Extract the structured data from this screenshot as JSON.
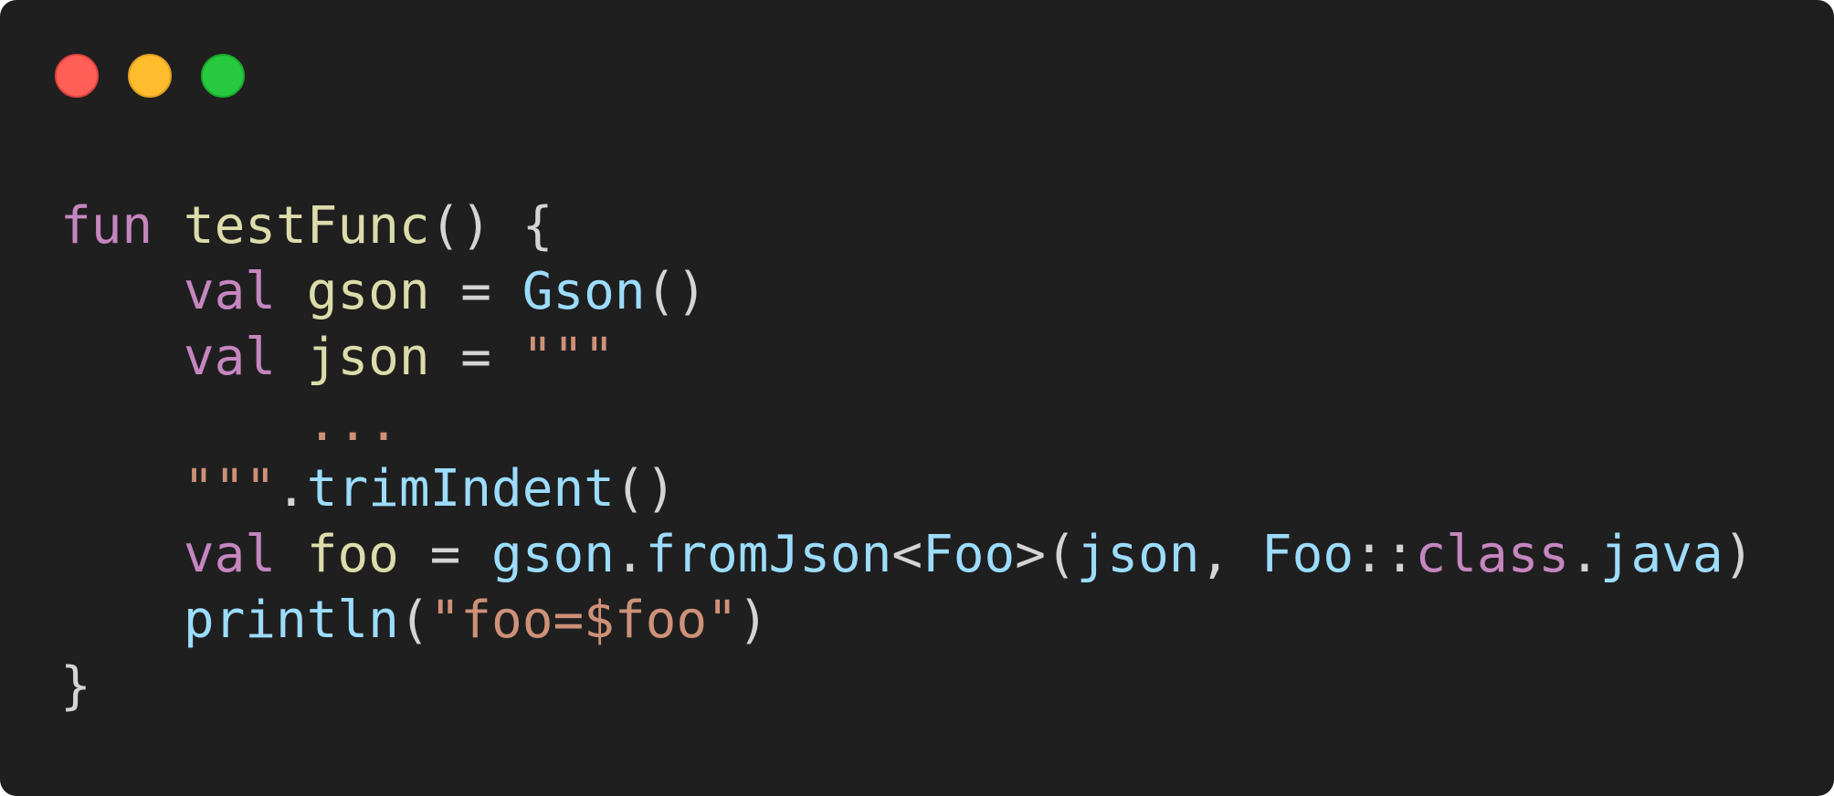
{
  "window": {
    "background": "#1f1f1f",
    "controls": [
      {
        "name": "close-button",
        "color": "#ff5f56",
        "border": "#e0443e"
      },
      {
        "name": "minimize-button",
        "color": "#ffbd2e",
        "border": "#dea123"
      },
      {
        "name": "zoom-button",
        "color": "#27c93f",
        "border": "#1aab29"
      }
    ]
  },
  "theme": {
    "keyword": "#c586c0",
    "variable": "#dcdcaa",
    "call": "#9cdcfe",
    "string": "#ce9178",
    "punctuation": "#d4d4d4"
  },
  "code": {
    "lines": [
      [
        {
          "text": "fun",
          "kind": "keyword"
        },
        {
          "text": " ",
          "kind": "punctuation"
        },
        {
          "text": "testFunc",
          "kind": "variable"
        },
        {
          "text": "() {",
          "kind": "punctuation"
        }
      ],
      [
        {
          "text": "    ",
          "kind": "punctuation"
        },
        {
          "text": "val",
          "kind": "keyword"
        },
        {
          "text": " ",
          "kind": "punctuation"
        },
        {
          "text": "gson",
          "kind": "variable"
        },
        {
          "text": " = ",
          "kind": "punctuation"
        },
        {
          "text": "Gson",
          "kind": "call"
        },
        {
          "text": "()",
          "kind": "punctuation"
        }
      ],
      [
        {
          "text": "    ",
          "kind": "punctuation"
        },
        {
          "text": "val",
          "kind": "keyword"
        },
        {
          "text": " ",
          "kind": "punctuation"
        },
        {
          "text": "json",
          "kind": "variable"
        },
        {
          "text": " = ",
          "kind": "punctuation"
        },
        {
          "text": "\"\"\"",
          "kind": "string"
        }
      ],
      [
        {
          "text": "        ",
          "kind": "punctuation"
        },
        {
          "text": "...",
          "kind": "string"
        }
      ],
      [
        {
          "text": "    ",
          "kind": "punctuation"
        },
        {
          "text": "\"\"\"",
          "kind": "string"
        },
        {
          "text": ".",
          "kind": "punctuation"
        },
        {
          "text": "trimIndent",
          "kind": "call"
        },
        {
          "text": "()",
          "kind": "punctuation"
        }
      ],
      [
        {
          "text": "    ",
          "kind": "punctuation"
        },
        {
          "text": "val",
          "kind": "keyword"
        },
        {
          "text": " ",
          "kind": "punctuation"
        },
        {
          "text": "foo",
          "kind": "variable"
        },
        {
          "text": " = ",
          "kind": "punctuation"
        },
        {
          "text": "gson",
          "kind": "call"
        },
        {
          "text": ".",
          "kind": "punctuation"
        },
        {
          "text": "fromJson",
          "kind": "call"
        },
        {
          "text": "<",
          "kind": "punctuation"
        },
        {
          "text": "Foo",
          "kind": "call"
        },
        {
          "text": ">(",
          "kind": "punctuation"
        },
        {
          "text": "json",
          "kind": "call"
        },
        {
          "text": ", ",
          "kind": "punctuation"
        },
        {
          "text": "Foo",
          "kind": "call"
        },
        {
          "text": "::",
          "kind": "punctuation"
        },
        {
          "text": "class",
          "kind": "keyword"
        },
        {
          "text": ".",
          "kind": "punctuation"
        },
        {
          "text": "java",
          "kind": "call"
        },
        {
          "text": ")",
          "kind": "punctuation"
        }
      ],
      [
        {
          "text": "    ",
          "kind": "punctuation"
        },
        {
          "text": "println",
          "kind": "call"
        },
        {
          "text": "(",
          "kind": "punctuation"
        },
        {
          "text": "\"foo=$foo\"",
          "kind": "string"
        },
        {
          "text": ")",
          "kind": "punctuation"
        }
      ],
      [
        {
          "text": "}",
          "kind": "punctuation"
        }
      ]
    ]
  }
}
